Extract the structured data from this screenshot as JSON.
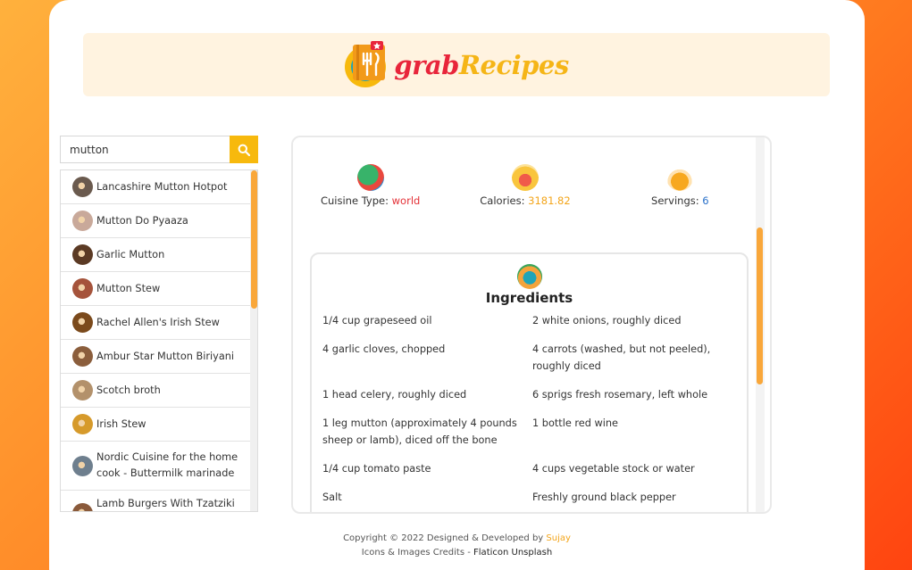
{
  "brand": {
    "part1": "grab",
    "part2": "Recipes"
  },
  "search": {
    "value": "mutton"
  },
  "recipes": [
    {
      "label": "Lancashire Mutton Hotpot",
      "color": "#6a5a4e"
    },
    {
      "label": "Mutton Do Pyaaza",
      "color": "#c9a99a"
    },
    {
      "label": "Garlic Mutton",
      "color": "#5b3a24"
    },
    {
      "label": "Mutton Stew",
      "color": "#a5533b"
    },
    {
      "label": "Rachel Allen's Irish Stew",
      "color": "#7b4a1c"
    },
    {
      "label": "Ambur Star Mutton Biriyani",
      "color": "#8b5e3c"
    },
    {
      "label": "Scotch broth",
      "color": "#b3916b"
    },
    {
      "label": "Irish Stew",
      "color": "#d69a2b"
    },
    {
      "label": "Nordic Cuisine for the home cook - Buttermilk marinade",
      "color": "#6e7f8e"
    },
    {
      "label": "Lamb Burgers With Tzatziki",
      "color": "#8a5a3b"
    }
  ],
  "stats": {
    "cuisine_label": "Cuisine Type:",
    "cuisine_value": "world",
    "calories_label": "Calories:",
    "calories_value": "3181.82",
    "servings_label": "Servings:",
    "servings_value": "6"
  },
  "ingredients": {
    "title": "Ingredients",
    "rows": [
      [
        "1/4 cup grapeseed oil",
        "2 white onions, roughly diced"
      ],
      [
        "4 garlic cloves, chopped",
        "4 carrots (washed, but not peeled), roughly diced"
      ],
      [
        "1 head celery, roughly diced",
        "6 sprigs fresh rosemary, left whole"
      ],
      [
        "1 leg mutton (approximately 4 pounds sheep or lamb), diced off the bone",
        "1 bottle red wine"
      ],
      [
        "1/4 cup tomato paste",
        "4 cups vegetable stock or water"
      ],
      [
        "Salt",
        "Freshly ground black pepper"
      ]
    ]
  },
  "footer": {
    "copyright": "Copyright © 2022 Designed & Developed by",
    "author": "Sujay",
    "credits": "Icons & Images Credits -",
    "sources": "Flaticon Unsplash"
  }
}
